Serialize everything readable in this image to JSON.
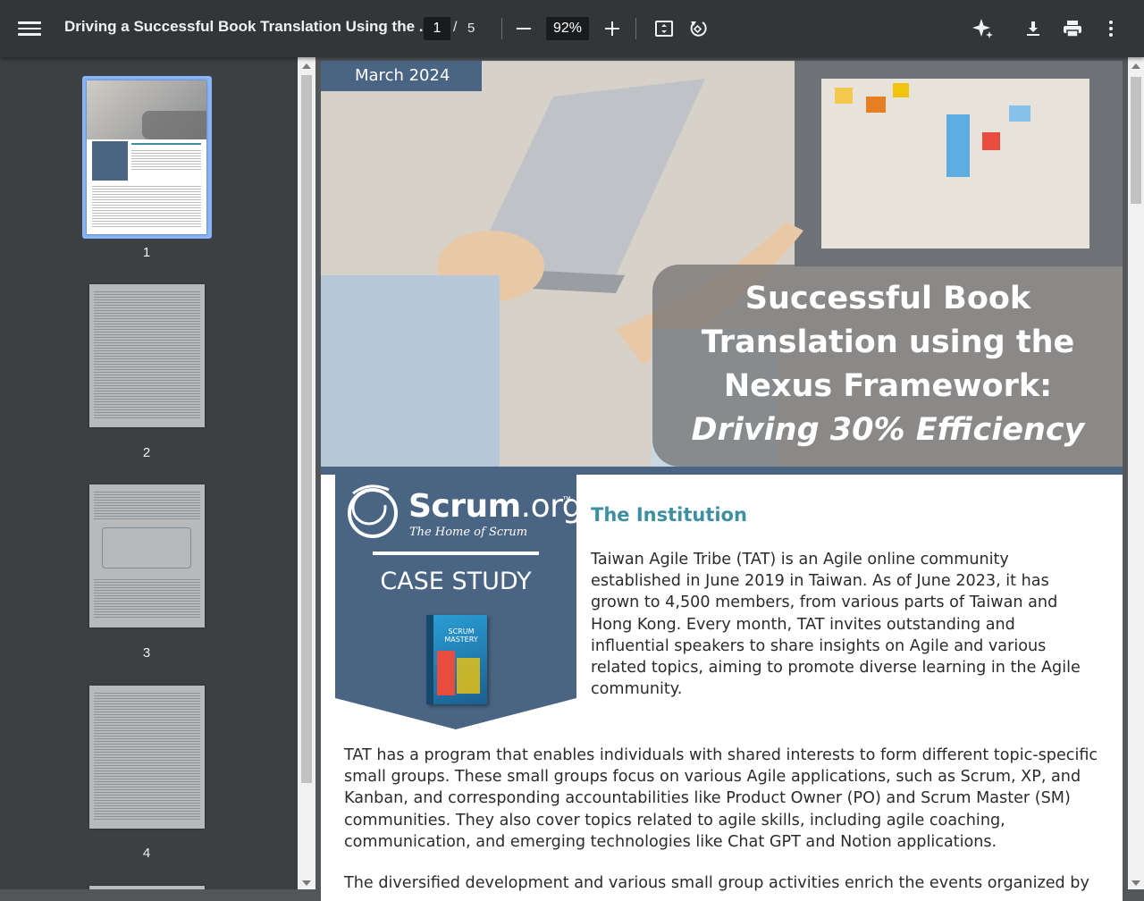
{
  "toolbar": {
    "title": "Driving a Successful Book Translation Using the ...",
    "current_page": "1",
    "page_separator": "/",
    "total_pages": "5",
    "zoom": "92%"
  },
  "sidebar": {
    "thumbnails": [
      {
        "label": "1"
      },
      {
        "label": "2"
      },
      {
        "label": "3"
      },
      {
        "label": "4"
      }
    ]
  },
  "document": {
    "date_banner": "March 2024",
    "hero_title_line1": "Successful Book",
    "hero_title_line2": "Translation using the",
    "hero_title_line3": "Nexus Framework:",
    "hero_title_line4": "Driving 30% Efficiency",
    "brand_name_bold": "Scrum",
    "brand_name_light": ".org",
    "brand_tm": "™",
    "brand_tagline": "The Home of Scrum",
    "case_study": "CASE STUDY",
    "book_title": "SCRUM MASTERY",
    "section_heading": "The Institution",
    "paragraph1": "Taiwan Agile Tribe (TAT) is an Agile online community established in June 2019 in Taiwan. As of June 2023, it has grown to 4,500 members, from various parts of Taiwan and Hong Kong. Every month, TAT invites outstanding and influential speakers to share insights on Agile and various related topics, aiming to promote diverse learning in the Agile community.",
    "paragraph2": "TAT has a program that enables individuals with shared interests to form different topic-specific small groups. These small groups focus on various Agile applications, such as Scrum, XP, and Kanban, and corresponding accountabilities like Product Owner (PO) and Scrum Master (SM) communities. They also cover topics related to agile skills, including agile coaching, communication, and emerging technologies like Chat GPT and Notion applications.",
    "paragraph3": "The diversified development and various small group activities enrich the events organized by"
  },
  "colors": {
    "toolbar_bg": "#323639",
    "sidebar_bg": "#3c4043",
    "brand_blue": "#4a6583",
    "heading_teal": "#3f8fa3",
    "selection": "#8ab4f8"
  },
  "icons": [
    "menu-icon",
    "zoom-out-icon",
    "zoom-in-icon",
    "fit-page-icon",
    "rotate-icon",
    "ai-sparkle-icon",
    "download-icon",
    "print-icon",
    "more-vert-icon"
  ]
}
